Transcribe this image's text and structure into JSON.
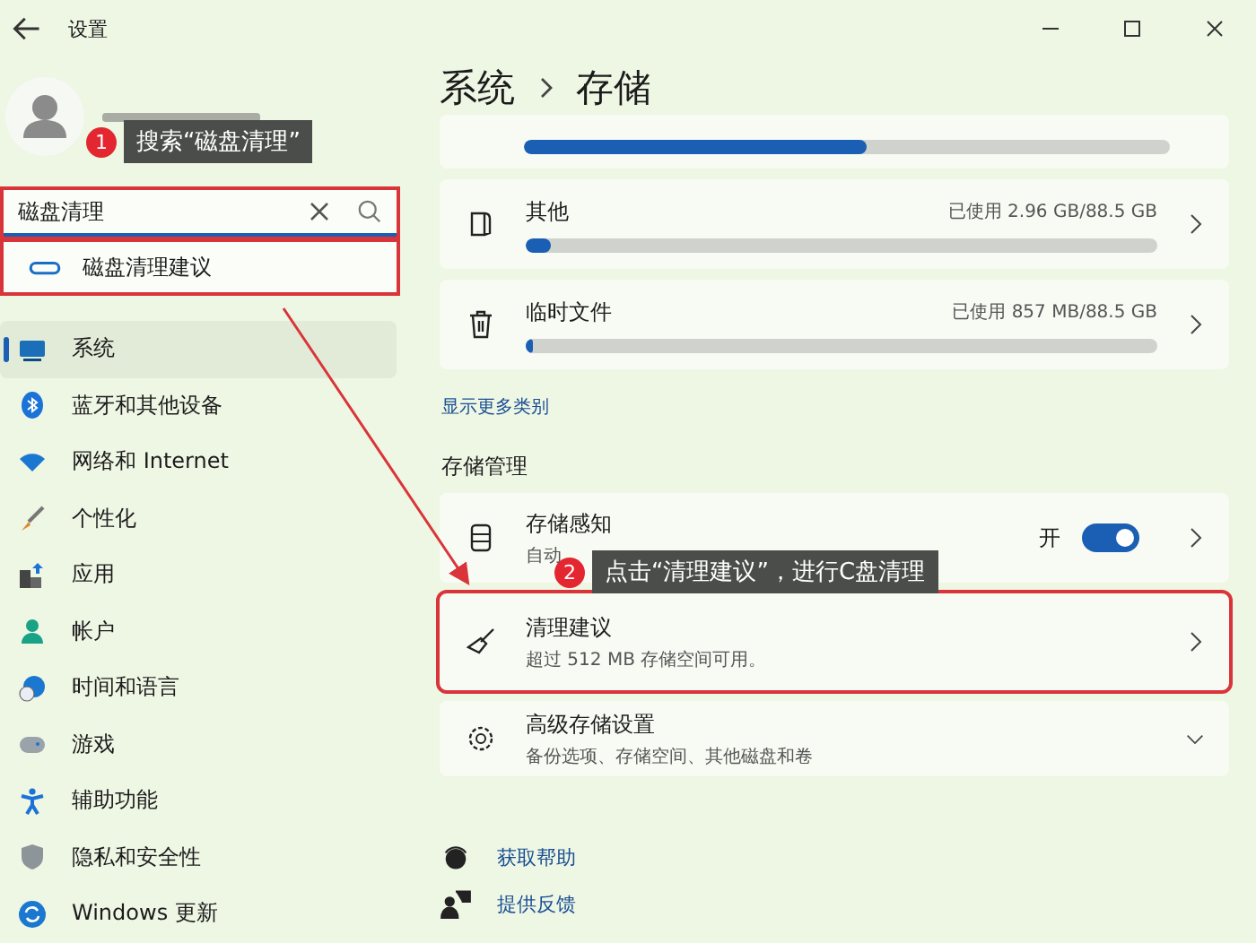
{
  "window": {
    "title": "设置"
  },
  "sidebar": {
    "search": {
      "value": "磁盘清理",
      "highlighted": true
    },
    "suggestions": [
      {
        "label": "磁盘清理建议",
        "highlighted": true
      }
    ],
    "items": [
      {
        "label": "系统",
        "selected": true
      },
      {
        "label": "蓝牙和其他设备",
        "selected": false
      },
      {
        "label": "网络和 Internet",
        "selected": false
      },
      {
        "label": "个性化",
        "selected": false
      },
      {
        "label": "应用",
        "selected": false
      },
      {
        "label": "帐户",
        "selected": false
      },
      {
        "label": "时间和语言",
        "selected": false
      },
      {
        "label": "游戏",
        "selected": false
      },
      {
        "label": "辅助功能",
        "selected": false
      },
      {
        "label": "隐私和安全性",
        "selected": false
      },
      {
        "label": "Windows 更新",
        "selected": false
      }
    ]
  },
  "breadcrumb": [
    "系统",
    "存储"
  ],
  "storage_items": [
    {
      "level": 0.53
    },
    {
      "name": "其他",
      "usage": "已使用 2.96 GB/88.5 GB",
      "level": 0.04
    },
    {
      "name": "临时文件",
      "usage": "已使用 857 MB/88.5 GB",
      "level": 0.01
    }
  ],
  "show_more": "显示更多类别",
  "management": {
    "heading": "存储管理",
    "rows": [
      {
        "kind": "toggle",
        "title": "存储感知",
        "subtitle": "自动",
        "state_label": "开",
        "on": true,
        "highlighted": false
      },
      {
        "kind": "link",
        "title": "清理建议",
        "subtitle": "超过 512 MB 存储空间可用。",
        "highlighted": true
      },
      {
        "kind": "expand",
        "title": "高级存储设置",
        "subtitle": "备份选项、存储空间、其他磁盘和卷",
        "highlighted": false
      }
    ]
  },
  "help_links": [
    "获取帮助",
    "提供反馈"
  ],
  "annotations": [
    {
      "number": "1",
      "text": "搜索“磁盘清理”"
    },
    {
      "number": "2",
      "text": "点击“清理建议”，进行C盘清理"
    }
  ]
}
